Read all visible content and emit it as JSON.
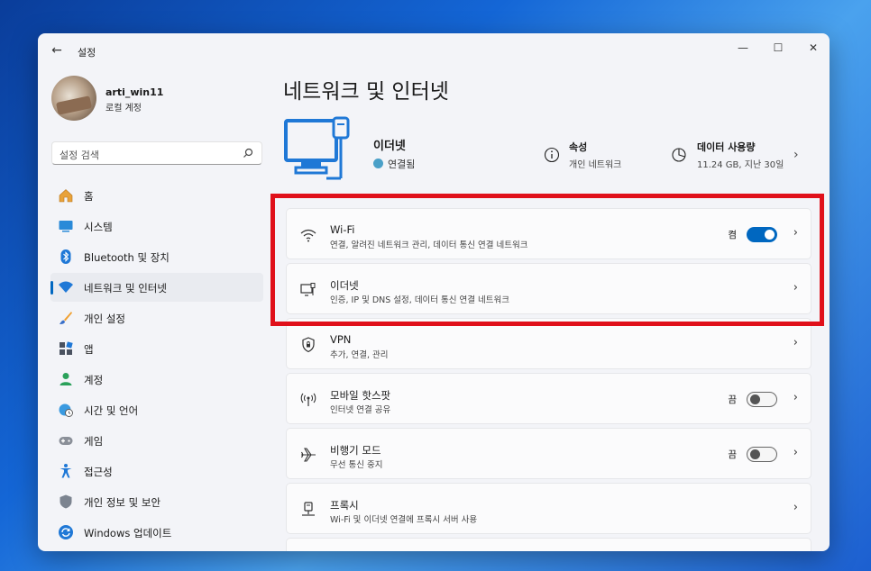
{
  "window": {
    "title": "설정",
    "controls": {
      "minimize": "—",
      "maximize": "☐",
      "close": "✕"
    }
  },
  "profile": {
    "name": "arti_win11",
    "account_type": "로컬 계정"
  },
  "search": {
    "placeholder": "설정 검색"
  },
  "sidebar": {
    "items": [
      {
        "label": "홈",
        "icon": "home-icon"
      },
      {
        "label": "시스템",
        "icon": "system-icon"
      },
      {
        "label": "Bluetooth 및 장치",
        "icon": "bluetooth-icon"
      },
      {
        "label": "네트워크 및 인터넷",
        "icon": "wifi-icon",
        "active": true
      },
      {
        "label": "개인 설정",
        "icon": "brush-icon"
      },
      {
        "label": "앱",
        "icon": "apps-icon"
      },
      {
        "label": "계정",
        "icon": "account-icon"
      },
      {
        "label": "시간 및 언어",
        "icon": "globe-clock-icon"
      },
      {
        "label": "게임",
        "icon": "gamepad-icon"
      },
      {
        "label": "접근성",
        "icon": "accessibility-icon"
      },
      {
        "label": "개인 정보 및 보안",
        "icon": "shield-icon"
      },
      {
        "label": "Windows 업데이트",
        "icon": "update-icon"
      }
    ]
  },
  "main": {
    "title": "네트워크 및 인터넷",
    "hero": {
      "connection_name": "이더넷",
      "connection_status": "연결됨",
      "properties": {
        "title": "속성",
        "subtitle": "개인 네트워크"
      },
      "data_usage": {
        "title": "데이터 사용량",
        "subtitle": "11.24 GB, 지난 30일"
      }
    },
    "cards": [
      {
        "title": "Wi-Fi",
        "subtitle": "연결, 알려진 네트워크 관리, 데이터 통신 연결 네트워크",
        "toggle": true,
        "toggle_label": "켬",
        "icon": "wifi-icon"
      },
      {
        "title": "이더넷",
        "subtitle": "인증, IP 및 DNS 설정, 데이터 통신 연결 네트워크",
        "icon": "ethernet-icon"
      },
      {
        "title": "VPN",
        "subtitle": "추가, 연결, 관리",
        "icon": "vpn-shield-icon"
      },
      {
        "title": "모바일 핫스팟",
        "subtitle": "인터넷 연결 공유",
        "toggle": false,
        "toggle_label": "끔",
        "icon": "hotspot-icon"
      },
      {
        "title": "비행기 모드",
        "subtitle": "무선 통신 중지",
        "toggle": false,
        "toggle_label": "끔",
        "icon": "airplane-icon"
      },
      {
        "title": "프록시",
        "subtitle": "Wi-Fi 및 이더넷 연결에 프록시 서버 사용",
        "icon": "proxy-icon"
      }
    ]
  },
  "colors": {
    "accent": "#0067c0",
    "highlight": "#e0101a"
  }
}
